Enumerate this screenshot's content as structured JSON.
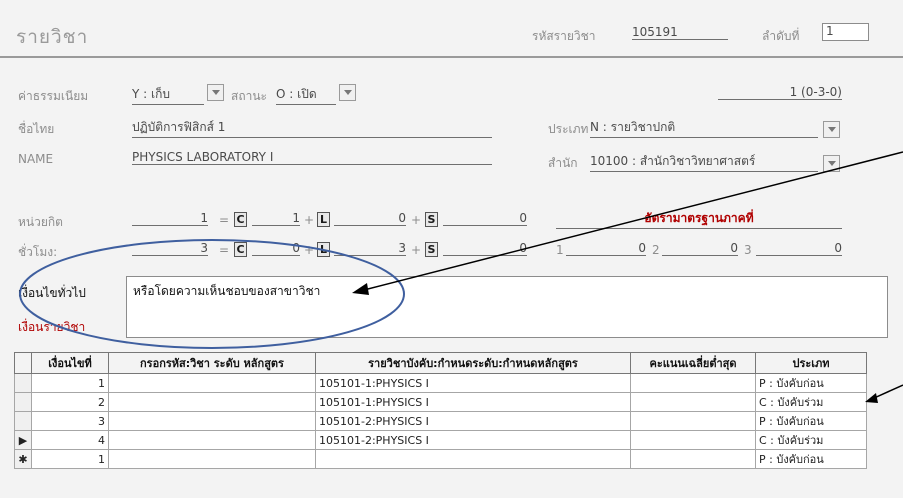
{
  "title": "รายวิชา",
  "course_code_label": "รหัสรายวิชา",
  "course_code": "105191",
  "order_label": "ลำดับที่",
  "order_value": "1",
  "fee_label": "ค่าธรรมเนียม",
  "fee_value": "Y : เก็บ",
  "status_label": "สถานะ",
  "status_value": "O : เปิด",
  "credit_summary": "1 (0-3-0)",
  "thai_name_label": "ชื่อไทย",
  "thai_name": "ปฏิบัติการฟิสิกส์ 1",
  "type_label": "ประเภท",
  "type_value": "N : รายวิชาปกติ",
  "name_label": "NAME",
  "name_value": "PHYSICS LABORATORY I",
  "office_label": "สำนัก",
  "office_value": "10100 : สำนักวิชาวิทยาศาสตร์",
  "credit_label": "หน่วยกิต",
  "credit_total": "1",
  "credit_c": "1",
  "credit_l": "0",
  "credit_s": "0",
  "hours_label": "ชั่วโมง:",
  "hours_total": "3",
  "hours_c": "0",
  "hours_l": "3",
  "hours_s": "0",
  "letter_c": "C",
  "letter_l": "L",
  "letter_s": "S",
  "op_eq": "=",
  "op_plus": "+",
  "rate_label": "อัตรามาตรฐานภาคที่",
  "rate_values": {
    "n1": "1",
    "v1": "0",
    "n2": "2",
    "v2": "0",
    "n3": "3",
    "v3": "0"
  },
  "general_cond_label": "เงื่อนไขทั่วไป",
  "general_cond_text": "หรือโดยความเห็นชอบของสาขาวิชา",
  "course_cond_label": "เงื่อนรายวิชา",
  "table": {
    "headers": [
      "เงื่อนไขที่",
      "กรอกรหัส:วิชา ระดับ หลักสูตร",
      "รายวิชาบังคับ:กำหนดระดับ:กำหนดหลักสูตร",
      "คะแนนเฉลี่ยต่ำสุด",
      "ประเภท"
    ],
    "rows": [
      {
        "marker": "",
        "no": "1",
        "code": "",
        "course": "105101-1:PHYSICS I",
        "score": "",
        "type": "P : บังคับก่อน"
      },
      {
        "marker": "",
        "no": "2",
        "code": "",
        "course": "105101-1:PHYSICS I",
        "score": "",
        "type": "C : บังคับร่วม"
      },
      {
        "marker": "",
        "no": "3",
        "code": "",
        "course": "105101-2:PHYSICS I",
        "score": "",
        "type": "P : บังคับก่อน"
      },
      {
        "marker": "▶",
        "no": "4",
        "code": "",
        "course": "105101-2:PHYSICS I",
        "score": "",
        "type": "C : บังคับร่วม"
      },
      {
        "marker": "✱",
        "no": "1",
        "code": "",
        "course": "",
        "score": "",
        "type": "P : บังคับก่อน"
      }
    ]
  },
  "colors": {
    "ellipse": "#3f5f9f",
    "arrow": "#000000",
    "label_red": "#b00000"
  }
}
